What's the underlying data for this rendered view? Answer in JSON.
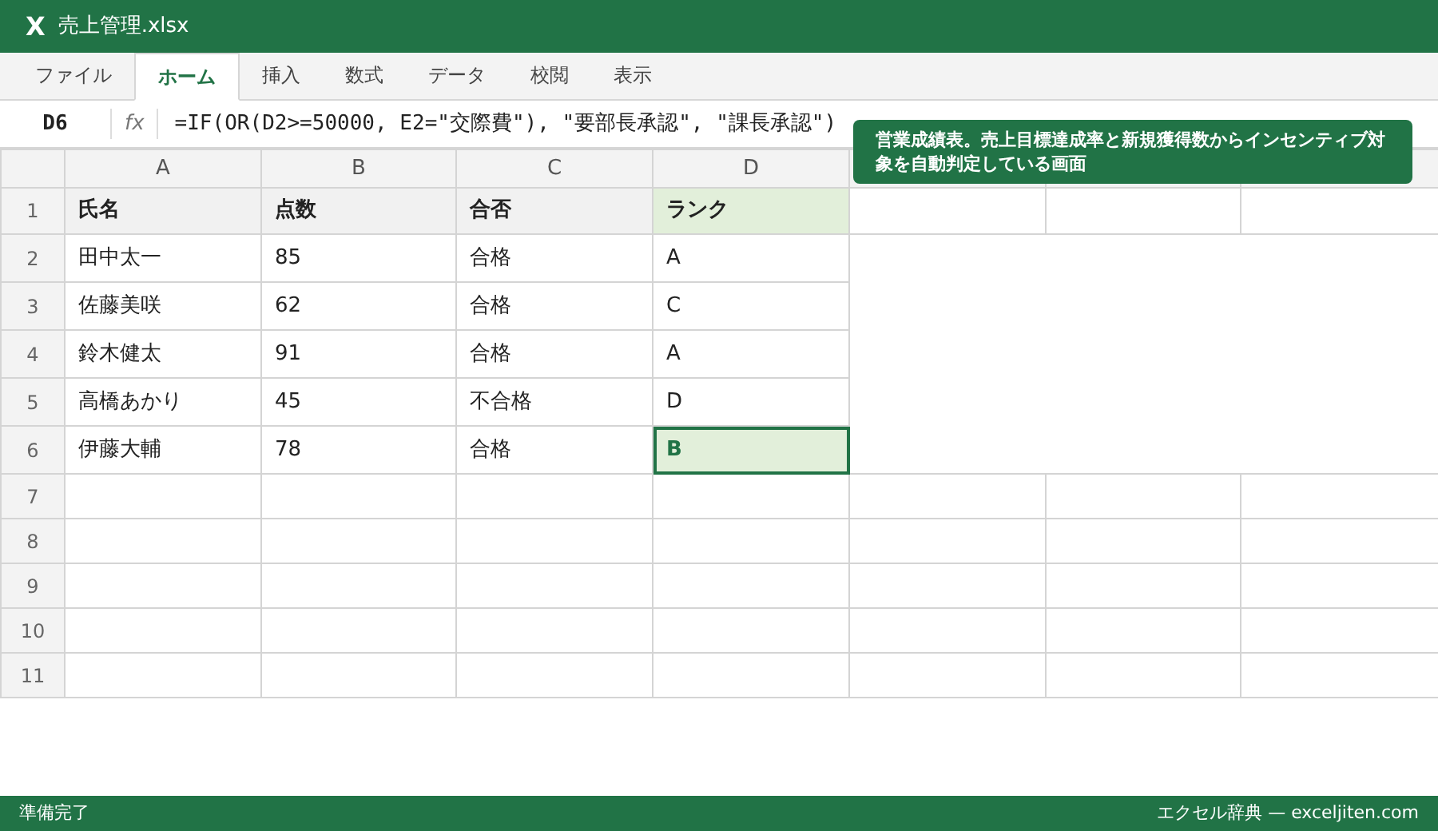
{
  "window": {
    "logo": "X",
    "title": "売上管理.xlsx"
  },
  "tabs": [
    {
      "label": "ファイル",
      "selected": false
    },
    {
      "label": "ホーム",
      "selected": true
    },
    {
      "label": "挿入",
      "selected": false
    },
    {
      "label": "数式",
      "selected": false
    },
    {
      "label": "データ",
      "selected": false
    },
    {
      "label": "校閲",
      "selected": false
    },
    {
      "label": "表示",
      "selected": false
    }
  ],
  "formula_bar": {
    "name_box": "D6",
    "fx": "fx",
    "formula": "=IF(OR(D2>=50000, E2=\"交際費\"), \"要部長承認\", \"課長承認\")"
  },
  "sheet": {
    "columns": [
      "A",
      "B",
      "C",
      "D"
    ],
    "rows": [
      {
        "number": "1",
        "kind": "header",
        "cells": [
          {
            "text": "氏名",
            "selected": false
          },
          {
            "text": "点数",
            "selected": false
          },
          {
            "text": "合否",
            "selected": false
          },
          {
            "text": "ランク",
            "selected": true
          }
        ]
      },
      {
        "number": "2",
        "kind": "data",
        "cells": [
          {
            "text": "田中太一",
            "selected": false
          },
          {
            "text": "85",
            "selected": false
          },
          {
            "text": "合格",
            "selected": false
          },
          {
            "text": "A",
            "selected": false
          }
        ]
      },
      {
        "number": "3",
        "kind": "data",
        "cells": [
          {
            "text": "佐藤美咲",
            "selected": false
          },
          {
            "text": "62",
            "selected": false
          },
          {
            "text": "合格",
            "selected": false
          },
          {
            "text": "C",
            "selected": false
          }
        ]
      },
      {
        "number": "4",
        "kind": "data",
        "cells": [
          {
            "text": "鈴木健太",
            "selected": false
          },
          {
            "text": "91",
            "selected": false
          },
          {
            "text": "合格",
            "selected": false
          },
          {
            "text": "A",
            "selected": false
          }
        ]
      },
      {
        "number": "5",
        "kind": "data",
        "cells": [
          {
            "text": "高橋あかり",
            "selected": false
          },
          {
            "text": "45",
            "selected": false
          },
          {
            "text": "不合格",
            "selected": false
          },
          {
            "text": "D",
            "selected": false
          }
        ]
      },
      {
        "number": "6",
        "kind": "data",
        "cells": [
          {
            "text": "伊藤大輔",
            "selected": false
          },
          {
            "text": "78",
            "selected": false
          },
          {
            "text": "合格",
            "selected": false
          },
          {
            "text": "B",
            "selected": true
          }
        ]
      },
      {
        "number": "7",
        "kind": "empty"
      },
      {
        "number": "8",
        "kind": "empty"
      },
      {
        "number": "9",
        "kind": "empty"
      },
      {
        "number": "10",
        "kind": "empty"
      },
      {
        "number": "11",
        "kind": "empty"
      }
    ]
  },
  "callout": "営業成績表。売上目標達成率と新規獲得数からインセンティブ対象を自動判定している画面",
  "status_bar": {
    "left": "準備完了",
    "right": "エクセル辞典 — exceljiten.com"
  }
}
